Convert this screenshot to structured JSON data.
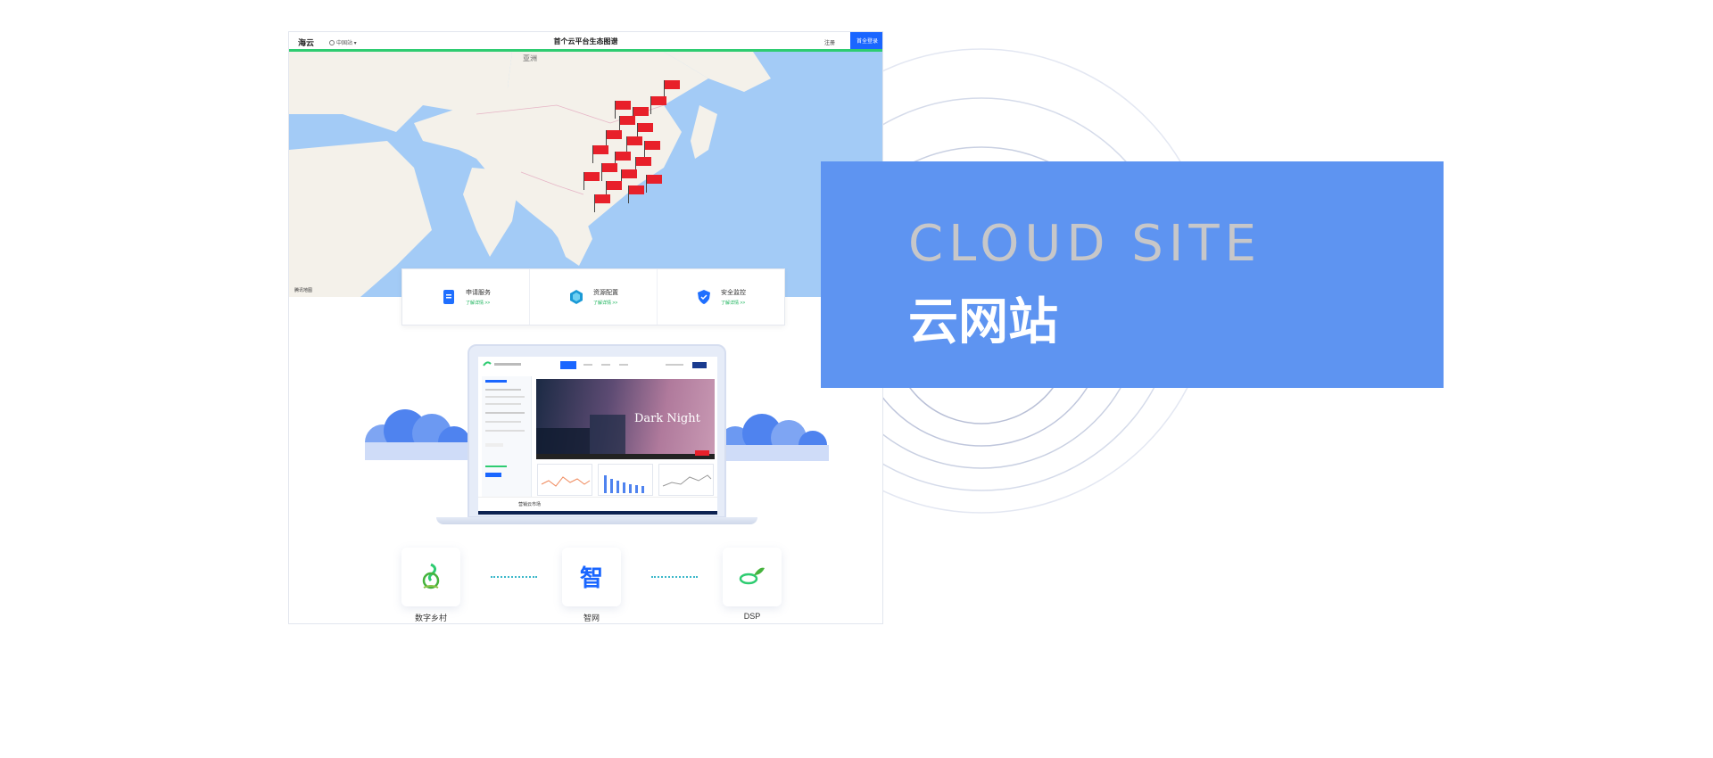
{
  "topbar": {
    "logo": "海云",
    "site_select": "中国站",
    "title": "首个云平台生态图谱",
    "register": "注册",
    "login": "首全登录"
  },
  "map": {
    "region_label": "亚洲",
    "credit": "腾讯地图"
  },
  "services": [
    {
      "title": "申请服务",
      "link": "了解详情 >>"
    },
    {
      "title": "资源配置",
      "link": "了解详情 >>"
    },
    {
      "title": "安全监控",
      "link": "了解详情 >>"
    }
  ],
  "laptop": {
    "hero_text": "Dark Night",
    "footer_title": "营销云市场"
  },
  "products": [
    {
      "label": "数字乡村",
      "icon": "leaf-swirl-icon"
    },
    {
      "label": "智网",
      "icon": "zhi-character-icon"
    },
    {
      "label": "DSP",
      "icon": "sprout-icon"
    }
  ],
  "banner": {
    "title_en": "CLOUD SITE",
    "title_cn": "云网站"
  },
  "colors": {
    "banner_bg": "#5e94f1",
    "accent_blue": "#1a66ff",
    "accent_green": "#2ecc71",
    "flag_red": "#e8202a"
  }
}
